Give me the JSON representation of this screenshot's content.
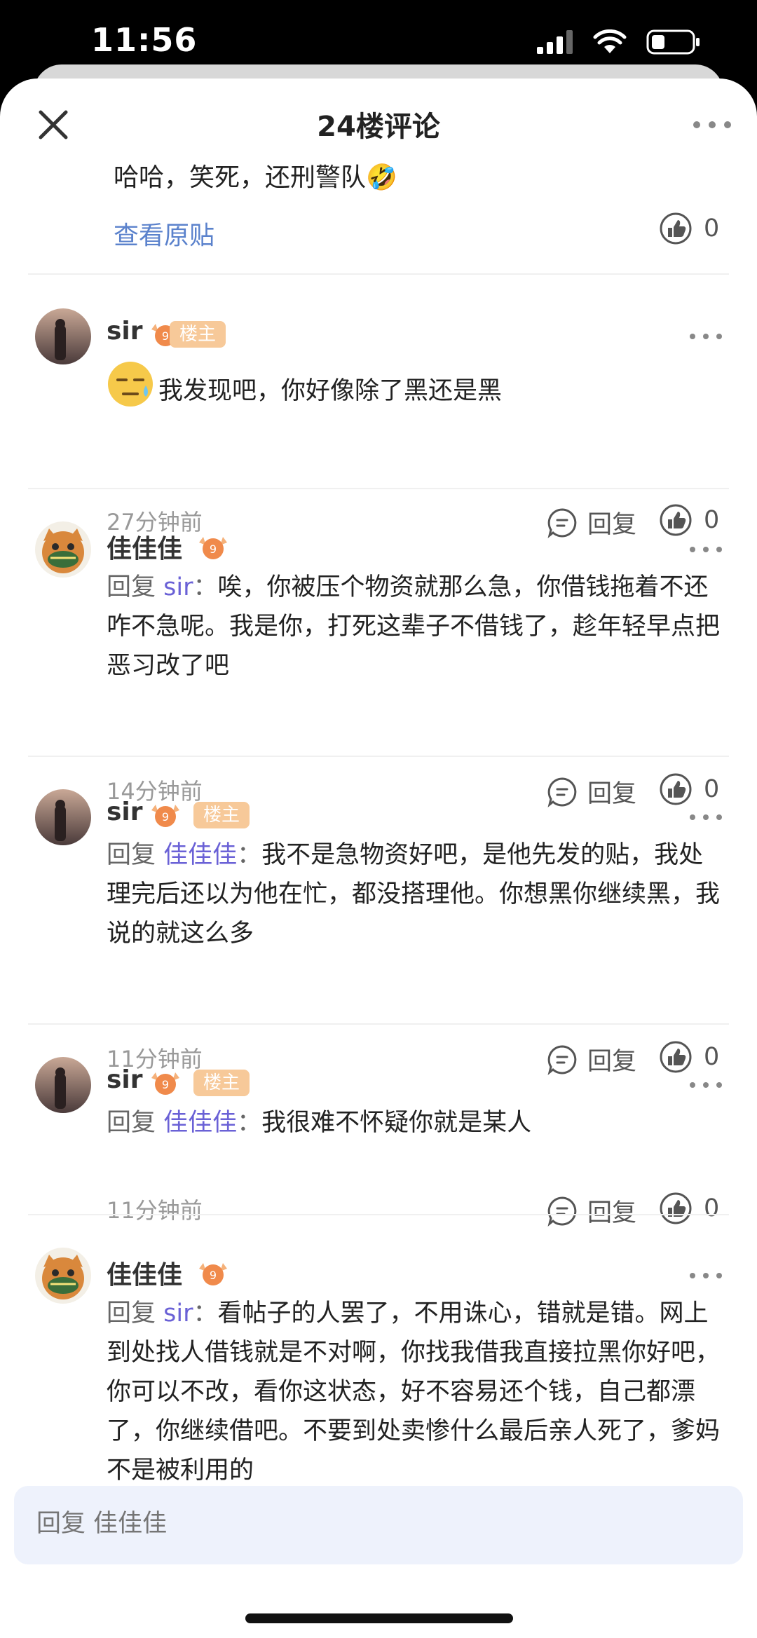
{
  "status": {
    "time": "11:56"
  },
  "header": {
    "title": "24楼评论"
  },
  "top": {
    "text": "哈哈，笑死，还刑警队🤣",
    "view_original": "查看原贴",
    "likes": "0"
  },
  "labels": {
    "reply": "回复",
    "owner_tag": "楼主",
    "level": "9"
  },
  "comments": [
    {
      "user": "sir",
      "owner": true,
      "text": "我发现吧，你好像除了黑还是黑",
      "time": "27分钟前",
      "likes": "0"
    },
    {
      "user": "佳佳佳",
      "owner": false,
      "reply_prefix": "回复 ",
      "reply_to": "sir",
      "colon": "：",
      "text": "唉，你被压个物资就那么急，你借钱拖着不还咋不急呢。我是你，打死这辈子不借钱了，趁年轻早点把恶习改了吧",
      "time": "14分钟前",
      "likes": "0"
    },
    {
      "user": "sir",
      "owner": true,
      "reply_prefix": "回复 ",
      "reply_to": "佳佳佳",
      "colon": "：",
      "text": "我不是急物资好吧，是他先发的贴，我处理完后还以为他在忙，都没搭理他。你想黑你继续黑，我说的就这么多",
      "time": "11分钟前",
      "likes": "0"
    },
    {
      "user": "sir",
      "owner": true,
      "reply_prefix": "回复 ",
      "reply_to": "佳佳佳",
      "colon": "：",
      "text": "我很难不怀疑你就是某人",
      "time": "11分钟前",
      "likes": "0"
    },
    {
      "user": "佳佳佳",
      "owner": false,
      "reply_prefix": "回复 ",
      "reply_to": "sir",
      "colon": "：",
      "text": "看帖子的人罢了，不用诛心，错就是错。网上到处找人借钱就是不对啊，你找我借我直接拉黑你好吧，你可以不改，看你这状态，好不容易还个钱，自己都漂了，你继续借吧。不要到处卖惨什么最后亲人死了，爹妈不是被利用的"
    }
  ],
  "reply_bar": {
    "placeholder": "回复 佳佳佳"
  }
}
